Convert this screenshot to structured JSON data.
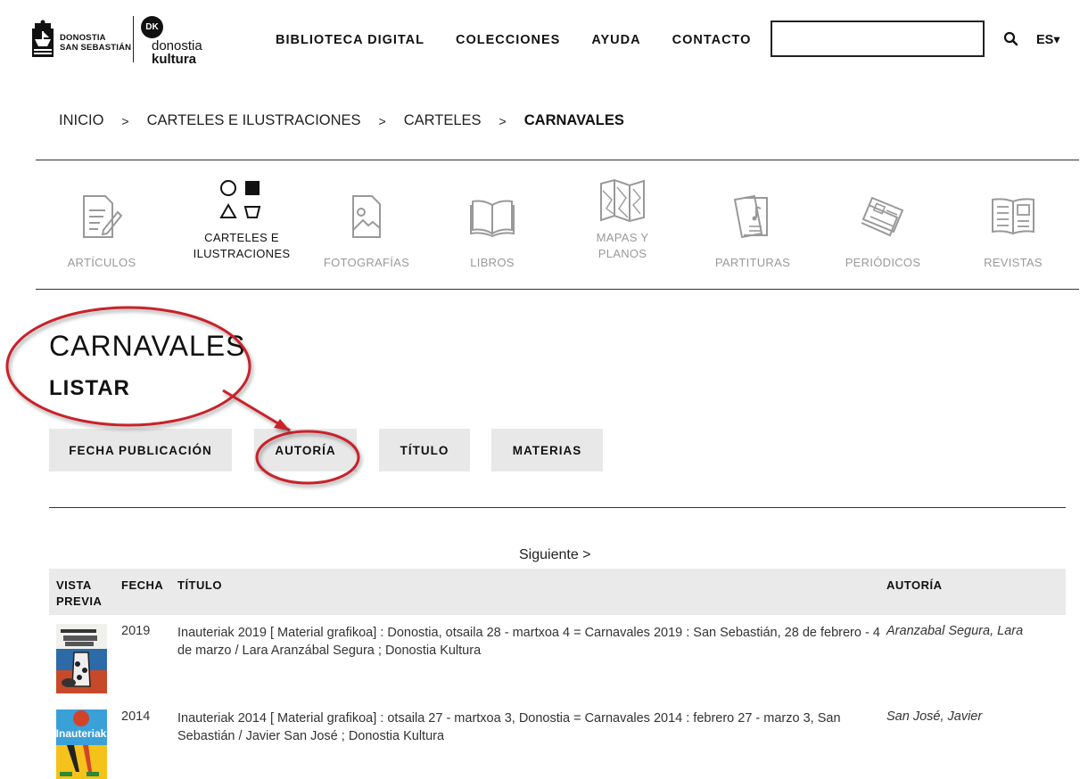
{
  "header": {
    "logo_left_line1": "DONOSTIA",
    "logo_left_line2": "SAN SEBASTIÁN",
    "logo_dk_badge": "DK",
    "logo_dk_line1": "donostia",
    "logo_dk_line2": "kultura",
    "nav": [
      "BIBLIOTECA DIGITAL",
      "COLECCIONES",
      "AYUDA",
      "CONTACTO"
    ],
    "search_value": "",
    "lang": "ES▾"
  },
  "breadcrumb": {
    "items": [
      "INICIO",
      "CARTELES E ILUSTRACIONES",
      "CARTELES"
    ],
    "current": "CARNAVALES",
    "separator": ">"
  },
  "categories": [
    {
      "label1": "",
      "label2": "ARTÍCULOS",
      "icon": "article-icon"
    },
    {
      "label1": "CARTELES E",
      "label2": "ILUSTRACIONES",
      "icon": "shapes-icon"
    },
    {
      "label1": "",
      "label2": "FOTOGRAFÍAS",
      "icon": "photo-icon"
    },
    {
      "label1": "",
      "label2": "LIBROS",
      "icon": "book-icon"
    },
    {
      "label1": "MAPAS Y",
      "label2": "PLANOS",
      "icon": "map-icon"
    },
    {
      "label1": "",
      "label2": "PARTITURAS",
      "icon": "score-icon"
    },
    {
      "label1": "",
      "label2": "PERIÓDICOS",
      "icon": "newspaper-icon"
    },
    {
      "label1": "",
      "label2": "REVISTAS",
      "icon": "magazine-icon"
    }
  ],
  "main": {
    "title": "CARNAVALES",
    "subtitle": "LISTAR",
    "sort_buttons": [
      "FECHA PUBLICACIÓN",
      "AUTORÍA",
      "TÍTULO",
      "MATERIAS"
    ],
    "next_label": "Siguiente >"
  },
  "table": {
    "headers": {
      "preview_1": "VISTA",
      "preview_2": "PREVIA",
      "date": "FECHA",
      "title": "TÍTULO",
      "author": "AUTORÍA"
    },
    "rows": [
      {
        "date": "2019",
        "title": "Inauteriak 2019 [ Material grafikoa] : Donostia, otsaila 28 - martxoa 4 = Carnavales 2019 : San Sebastián, 28 de febrero - 4 de marzo / Lara Aranzábal Segura ; Donostia Kultura",
        "author": "Aranzabal Segura, Lara"
      },
      {
        "date": "2014",
        "title": "Inauteriak 2014 [ Material grafikoa] : otsaila 27 - martxoa 3, Donostia = Carnavales 2014 : febrero 27 - marzo 3, San Sebastián / Javier San José ; Donostia Kultura",
        "author": "San José, Javier",
        "thumb_text": "Inauteriak"
      }
    ]
  },
  "colors": {
    "annotation": "#c8202a",
    "button_bg": "#e8e8e8",
    "header_bg": "#eaeaea"
  }
}
